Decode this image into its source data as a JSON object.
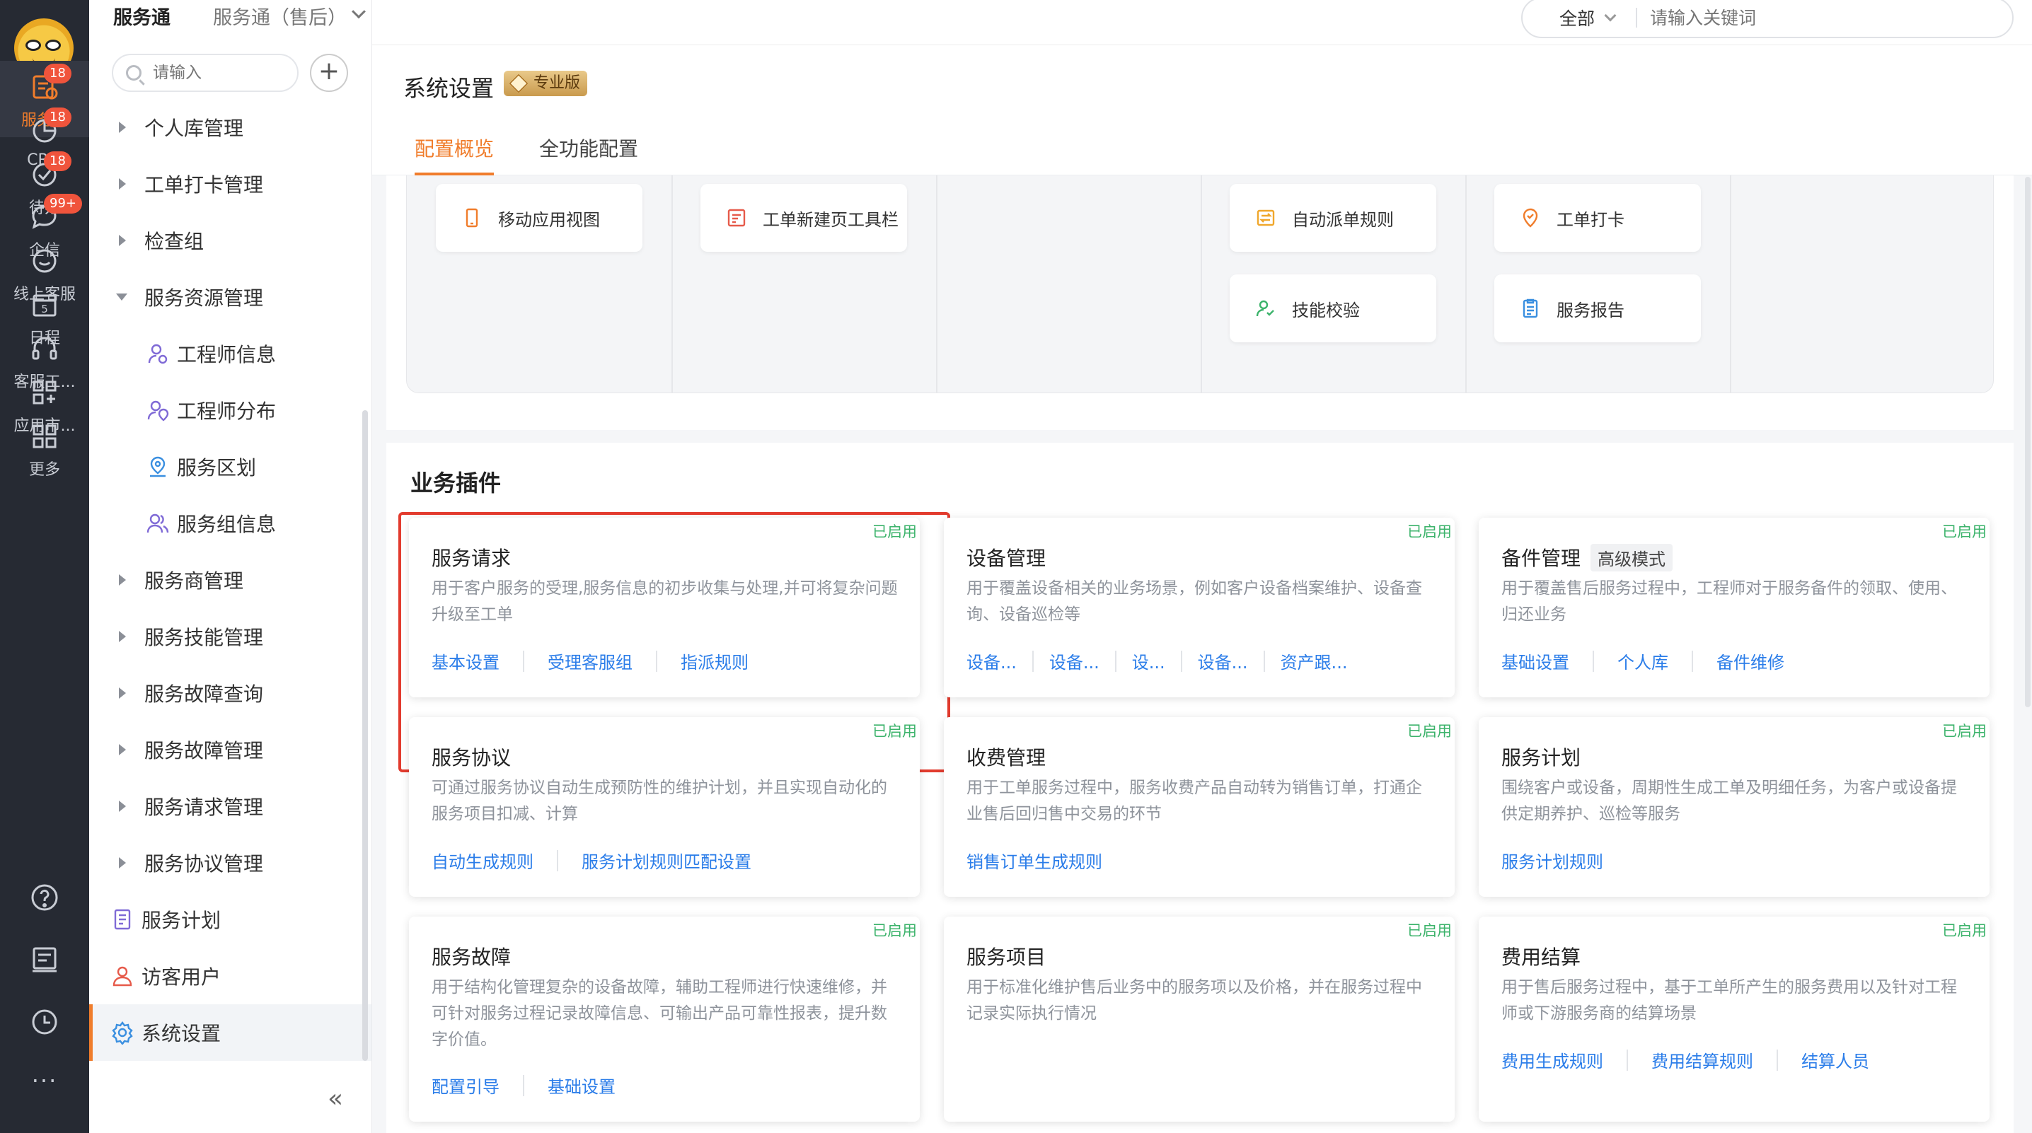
{
  "rail": {
    "items": [
      {
        "label": "服务通",
        "badge": "18",
        "active": true
      },
      {
        "label": "CRM",
        "badge": "18"
      },
      {
        "label": "待办",
        "badge": "18"
      },
      {
        "label": "企信",
        "badge": "99+"
      },
      {
        "label": "线上客服",
        "badge": ""
      },
      {
        "label": "日程",
        "badge": ""
      },
      {
        "label": "客服工...",
        "badge": ""
      },
      {
        "label": "应用市...",
        "badge": ""
      },
      {
        "label": "更多",
        "badge": ""
      }
    ],
    "calendar_day": "5",
    "more_dots": "···"
  },
  "sidebar": {
    "app_title": "服务通",
    "app_subtitle": "服务通（售后）",
    "search_placeholder": "请输入",
    "add_symbol": "+",
    "collapse_symbol": "«",
    "items": [
      {
        "label": "个人库管理",
        "type": "group"
      },
      {
        "label": "工单打卡管理",
        "type": "group"
      },
      {
        "label": "检查组",
        "type": "group"
      },
      {
        "label": "服务资源管理",
        "type": "group-open"
      },
      {
        "label": "工程师信息",
        "type": "child"
      },
      {
        "label": "工程师分布",
        "type": "child"
      },
      {
        "label": "服务区划",
        "type": "child"
      },
      {
        "label": "服务组信息",
        "type": "child"
      },
      {
        "label": "服务商管理",
        "type": "group"
      },
      {
        "label": "服务技能管理",
        "type": "group"
      },
      {
        "label": "服务故障查询",
        "type": "group"
      },
      {
        "label": "服务故障管理",
        "type": "group"
      },
      {
        "label": "服务请求管理",
        "type": "group"
      },
      {
        "label": "服务协议管理",
        "type": "group"
      },
      {
        "label": "服务计划",
        "type": "leaf"
      },
      {
        "label": "访客用户",
        "type": "leaf"
      },
      {
        "label": "系统设置",
        "type": "leaf",
        "active": true
      }
    ]
  },
  "topbar": {
    "scope": "全部",
    "search_placeholder": "请输入关键词"
  },
  "page": {
    "title": "系统设置",
    "edition_badge": "专业版",
    "tabs": [
      {
        "label": "配置概览",
        "active": true
      },
      {
        "label": "全功能配置",
        "active": false
      }
    ]
  },
  "flow_chips": [
    {
      "label": "移动应用视图",
      "icon": "mobile-icon"
    },
    {
      "label": "工单新建页工具栏",
      "icon": "toolbar-icon"
    },
    {
      "label": "自动派单规则",
      "icon": "dispatch-rule-icon"
    },
    {
      "label": "工单打卡",
      "icon": "checkin-icon"
    },
    {
      "label": "技能校验",
      "icon": "skill-check-icon"
    },
    {
      "label": "服务报告",
      "icon": "report-icon"
    }
  ],
  "plugins": {
    "section_title": "业务插件",
    "cards": [
      {
        "title": "服务请求",
        "tag": "",
        "status": "已启用",
        "desc": "用于客户服务的受理,服务信息的初步收集与处理,并可将复杂问题升级至工单",
        "links": [
          "基本设置",
          "受理客服组",
          "指派规则"
        ]
      },
      {
        "title": "设备管理",
        "tag": "",
        "status": "已启用",
        "desc": "用于覆盖设备相关的业务场景，例如客户设备档案维护、设备查询、设备巡检等",
        "links": [
          "设备...",
          "设备...",
          "设...",
          "设备...",
          "资产跟..."
        ]
      },
      {
        "title": "备件管理",
        "tag": "高级模式",
        "status": "已启用",
        "desc": "用于覆盖售后服务过程中，工程师对于服务备件的领取、使用、归还业务",
        "links": [
          "基础设置",
          "个人库",
          "备件维修"
        ]
      },
      {
        "title": "服务协议",
        "tag": "",
        "status": "已启用",
        "desc": "可通过服务协议自动生成预防性的维护计划，并且实现自动化的服务项目扣减、计算",
        "links": [
          "自动生成规则",
          "服务计划规则匹配设置"
        ]
      },
      {
        "title": "收费管理",
        "tag": "",
        "status": "已启用",
        "desc": "用于工单服务过程中，服务收费产品自动转为销售订单，打通企业售后回归售中交易的环节",
        "links": [
          "销售订单生成规则"
        ]
      },
      {
        "title": "服务计划",
        "tag": "",
        "status": "已启用",
        "desc": "围绕客户或设备，周期性生成工单及明细任务，为客户或设备提供定期养护、巡检等服务",
        "links": [
          "服务计划规则"
        ]
      },
      {
        "title": "服务故障",
        "tag": "",
        "status": "已启用",
        "desc": "用于结构化管理复杂的设备故障，辅助工程师进行快速维修，并可针对服务过程记录故障信息、可输出产品可靠性报表，提升数字价值。",
        "links": [
          "配置引导",
          "基础设置"
        ]
      },
      {
        "title": "服务项目",
        "tag": "",
        "status": "已启用",
        "desc": "用于标准化维护售后业务中的服务项以及价格，并在服务过程中记录实际执行情况",
        "links": []
      },
      {
        "title": "费用结算",
        "tag": "",
        "status": "已启用",
        "desc": "用于售后服务过程中，基于工单所产生的服务费用以及针对工程师或下游服务商的结算场景",
        "links": [
          "费用生成规则",
          "费用结算规则",
          "结算人员"
        ]
      }
    ]
  },
  "colors": {
    "accent": "#f07d2c",
    "link": "#2b7de9",
    "enabled": "#3cb36b",
    "highlight": "#e23b2e",
    "badge": "#f0543c"
  }
}
